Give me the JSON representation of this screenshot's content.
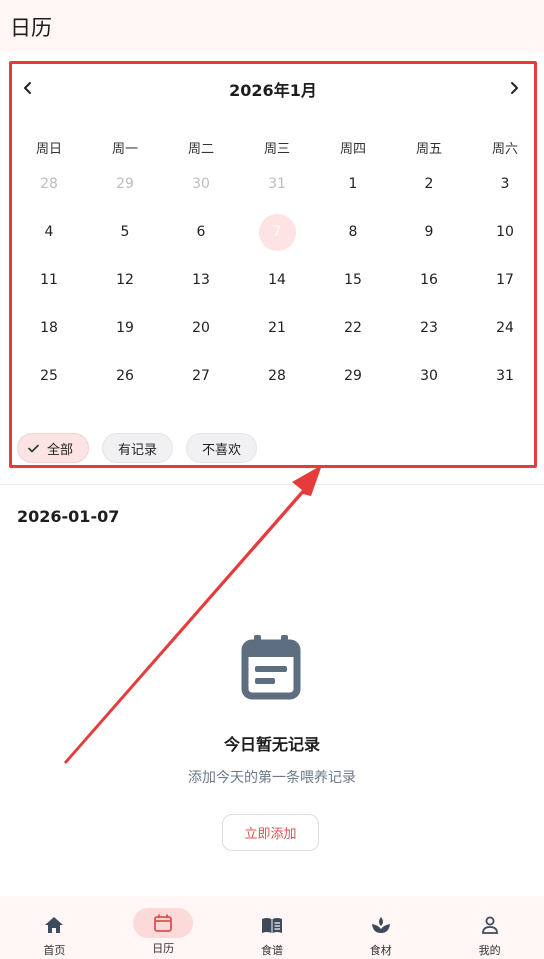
{
  "appbar": {
    "title": "日历"
  },
  "calendar": {
    "month_title": "2026年1月",
    "weekdays": [
      "周日",
      "周一",
      "周二",
      "周三",
      "周四",
      "周五",
      "周六"
    ],
    "weeks": [
      [
        "28",
        "29",
        "30",
        "31",
        "1",
        "2",
        "3"
      ],
      [
        "4",
        "5",
        "6",
        "7",
        "8",
        "9",
        "10"
      ],
      [
        "11",
        "12",
        "13",
        "14",
        "15",
        "16",
        "17"
      ],
      [
        "18",
        "19",
        "20",
        "21",
        "22",
        "23",
        "24"
      ],
      [
        "25",
        "26",
        "27",
        "28",
        "29",
        "30",
        "31"
      ]
    ],
    "selected_day": "7"
  },
  "filters": [
    {
      "label": "全部",
      "active": true
    },
    {
      "label": "有记录",
      "active": false
    },
    {
      "label": "不喜欢",
      "active": false
    }
  ],
  "selected_date": "2026-01-07",
  "empty": {
    "title": "今日暂无记录",
    "subtitle": "添加今天的第一条喂养记录",
    "add_label": "立即添加"
  },
  "bottom_nav": [
    {
      "label": "首页",
      "icon": "home-icon",
      "active": false
    },
    {
      "label": "日历",
      "icon": "calendar-icon",
      "active": true
    },
    {
      "label": "食谱",
      "icon": "book-icon",
      "active": false
    },
    {
      "label": "食材",
      "icon": "sprout-icon",
      "active": false
    },
    {
      "label": "我的",
      "icon": "person-icon",
      "active": false
    }
  ],
  "colors": {
    "accent": "#e05050",
    "highlight_border": "#e53b3b",
    "selected_fill": "#fde3e3",
    "appbar_bg": "#fff6f5"
  }
}
